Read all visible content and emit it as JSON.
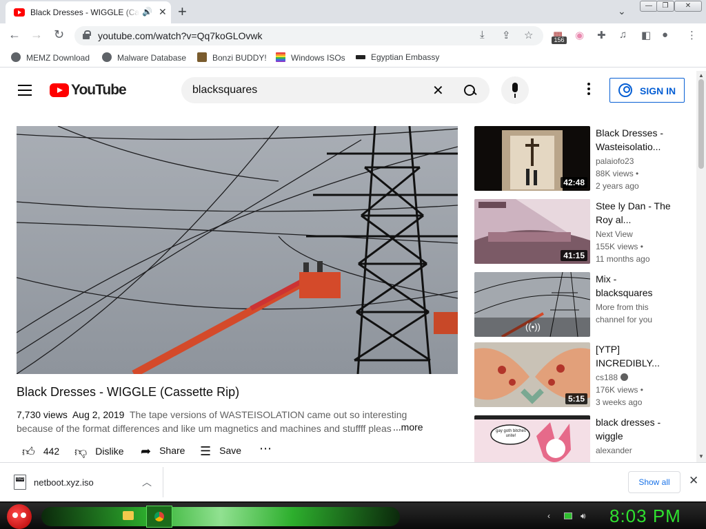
{
  "browser": {
    "tab_title": "Black Dresses - WIGGLE (Cassette Rip)",
    "url": "youtube.com/watch?v=Qq7koGLOvwk",
    "extension_badge": "156",
    "bookmarks": [
      {
        "label": "MEMZ Download",
        "icon": "globe-icon",
        "color": "#5f6368"
      },
      {
        "label": "Malware Database",
        "icon": "globe-icon",
        "color": "#5f6368"
      },
      {
        "label": "Bonzi BUDDY!",
        "icon": "bonzi-icon",
        "color": "#7a5c2e"
      },
      {
        "label": "Windows ISOs",
        "icon": "windows-flag-icon",
        "color": "#e94040"
      },
      {
        "label": "Egyptian Embassy",
        "icon": "wix-icon",
        "color": "#222222"
      }
    ]
  },
  "youtube": {
    "logo_text": "YouTube",
    "search_value": "blacksquares",
    "sign_in": "SIGN IN",
    "video": {
      "title": "Black Dresses - WIGGLE (Cassette Rip)",
      "views": "7,730 views",
      "date": "Aug 2, 2019",
      "description": "The tape versions of WASTEISOLATION came out so interesting because of the format differences and like um magnetics and machines and stuffff please listen",
      "more": "...more",
      "likes": "442",
      "dislike": "Dislike",
      "share": "Share",
      "save": "Save"
    },
    "recommendations": [
      {
        "title": "Black Dresses - Wasteisolatio...",
        "channel": "palaiofo23",
        "meta1": "88K views •",
        "meta2": "2 years ago",
        "duration": "42:48"
      },
      {
        "title": "Stee ly Dan - The Roy al...",
        "channel": "Next View",
        "meta1": "155K views •",
        "meta2": "11 months ago",
        "duration": "41:15"
      },
      {
        "title": "Mix - blacksquares",
        "channel": "More from this",
        "meta1": "channel for you",
        "meta2": "",
        "duration": ""
      },
      {
        "title": "[YTP] INCREDIBLY...",
        "channel": "cs188",
        "meta1": "176K views •",
        "meta2": "3 weeks ago",
        "duration": "5:15"
      },
      {
        "title": "black dresses - wiggle",
        "channel": "alexander",
        "meta1": "",
        "meta2": "",
        "duration": ""
      }
    ],
    "thumb_caption": "gay goth bitches unite!"
  },
  "downloads": {
    "filename": "netboot.xyz.iso",
    "show_all": "Show all"
  },
  "taskbar": {
    "clock": "8:03 PM"
  }
}
